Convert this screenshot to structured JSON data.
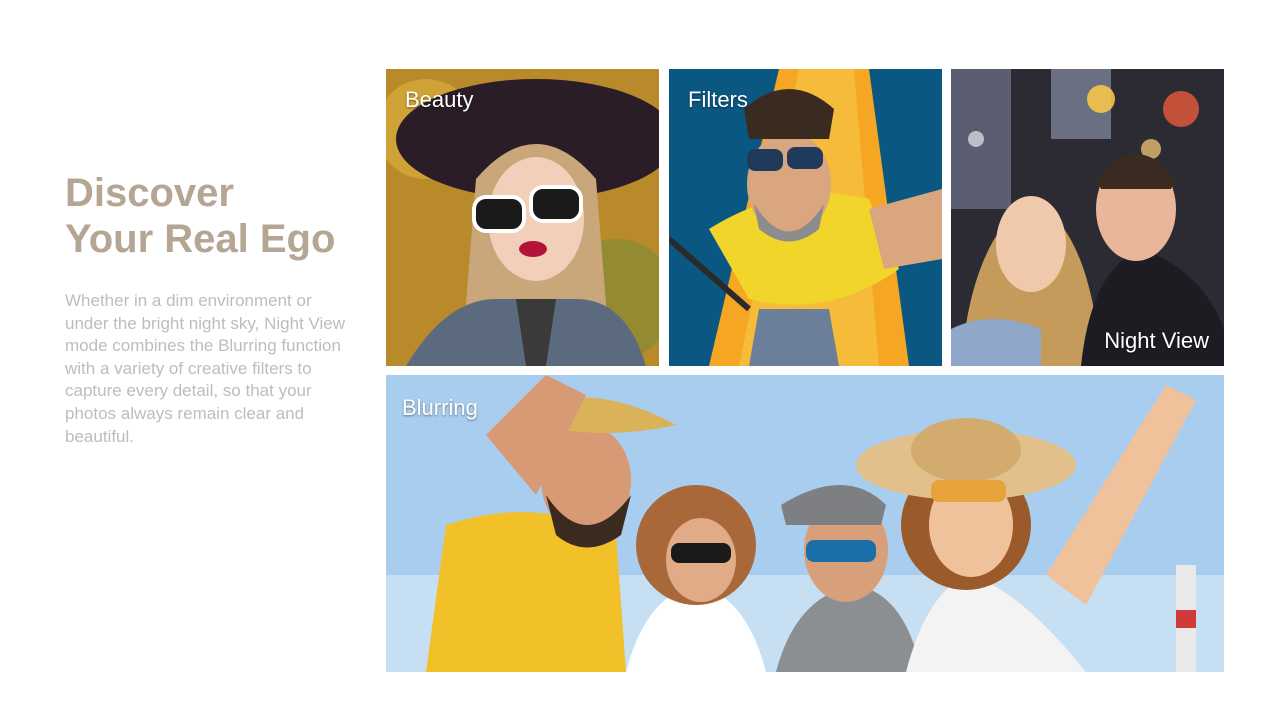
{
  "slide": {
    "headline_line1": "Discover",
    "headline_line2": "Your Real Ego",
    "body": "Whether in a dim environment or under the bright night sky, Night View mode combines the Blurring function with a variety of creative filters to capture every detail, so that your photos always remain clear and beautiful."
  },
  "tiles": {
    "beauty": {
      "label": "Beauty"
    },
    "filters": {
      "label": "Filters"
    },
    "night_view": {
      "label": "Night View"
    },
    "blurring": {
      "label": "Blurring"
    }
  },
  "colors": {
    "headline": "#b5a593",
    "body_text": "#bdbdbd",
    "label_text": "#ffffff"
  }
}
